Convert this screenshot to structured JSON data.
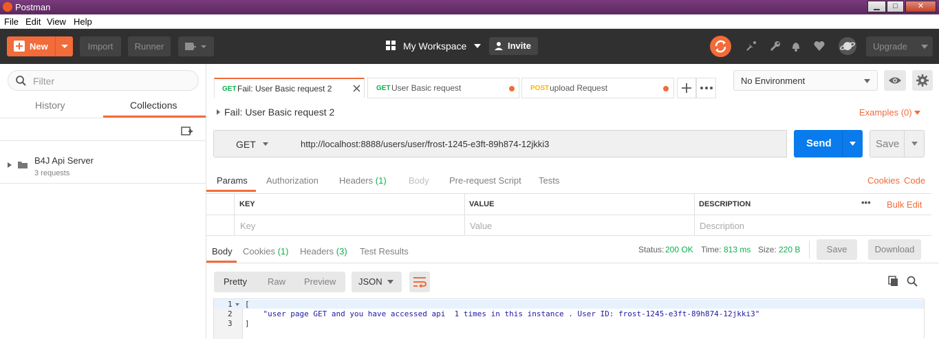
{
  "window": {
    "title": "Postman",
    "min": "▁",
    "max": "□",
    "close": "✕"
  },
  "menu": [
    "File",
    "Edit",
    "View",
    "Help"
  ],
  "header": {
    "new_label": "New",
    "import_label": "Import",
    "runner_label": "Runner",
    "workspace": "My Workspace",
    "invite_label": "Invite",
    "upgrade_label": "Upgrade"
  },
  "sidebar": {
    "filter_placeholder": "Filter",
    "tabs": [
      "History",
      "Collections"
    ],
    "active_tab": "Collections",
    "collections": [
      {
        "name": "B4J Api Server",
        "meta": "3 requests"
      }
    ]
  },
  "tabs": [
    {
      "method": "GET",
      "title": "Fail: User Basic request 2",
      "active": true
    },
    {
      "method": "GET",
      "title": "User Basic request",
      "unsaved": true
    },
    {
      "method": "POST",
      "title": "upload Request",
      "unsaved": true
    }
  ],
  "environment": {
    "selected": "No Environment"
  },
  "request": {
    "name": "Fail: User Basic request 2",
    "examples": "Examples (0)",
    "method": "GET",
    "url": "http://localhost:8888/users/user/frost-1245-e3ft-89h874-12jkki3",
    "send_label": "Send",
    "save_label": "Save",
    "tabs": {
      "params": "Params",
      "authorization": "Authorization",
      "headers": "Headers",
      "headers_count": "(1)",
      "body": "Body",
      "prerequest": "Pre-request Script",
      "tests": "Tests"
    },
    "cookies": "Cookies",
    "code": "Code",
    "params_table": {
      "headers": [
        "KEY",
        "VALUE",
        "DESCRIPTION"
      ],
      "bulk_edit": "Bulk Edit",
      "more": "•••",
      "placeholders": [
        "Key",
        "Value",
        "Description"
      ]
    }
  },
  "response": {
    "tabs": {
      "body": "Body",
      "cookies": "Cookies",
      "cookies_count": "(1)",
      "headers": "Headers",
      "headers_count": "(3)",
      "tests": "Test Results"
    },
    "status_label": "Status:",
    "status": "200 OK",
    "time_label": "Time:",
    "time": "813 ms",
    "size_label": "Size:",
    "size": "220 B",
    "save_label": "Save",
    "download_label": "Download",
    "formats": [
      "Pretty",
      "Raw",
      "Preview"
    ],
    "language": "JSON",
    "lines": [
      {
        "n": "1",
        "text": "["
      },
      {
        "n": "2",
        "text": "    \"user page GET and you have accessed api  1 times in this instance . User ID: frost-1245-e3ft-89h874-12jkki3\""
      },
      {
        "n": "3",
        "text": "]"
      }
    ]
  },
  "colors": {
    "accent": "#f26b3a",
    "send": "#097bed",
    "get": "#0cb04d",
    "post": "#ffb400"
  }
}
